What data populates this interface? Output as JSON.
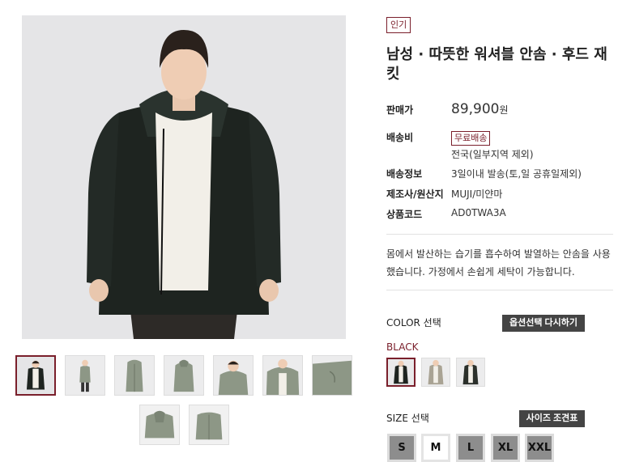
{
  "product": {
    "badge": "인기",
    "title": "남성 · 따뜻한 워셔블 안솜 · 후드 재킷",
    "price_label": "판매가",
    "price": "89,900",
    "price_unit": "원",
    "shipping_label": "배송비",
    "shipping_badge": "무료배송",
    "shipping_note": "전국(일부지역 제외)",
    "delivery_label": "배송정보",
    "delivery_value": "3일이내 발송(토,일 공휴일제외)",
    "maker_label": "제조사/원산지",
    "maker_value": "MUJI/미얀마",
    "code_label": "상품코드",
    "code_value": "AD0TWA3A",
    "description": "몸에서 발산하는 습기를 흡수하여 발열하는 안솜을 사용했습니다. 가정에서 손쉽게 세탁이 가능합니다."
  },
  "options": {
    "color_label": "COLOR 선택",
    "reset_label": "옵션선택 다시하기",
    "selected_color": "BLACK",
    "size_label": "SIZE 선택",
    "size_chart_label": "사이즈 조견표",
    "sizes": [
      "S",
      "M",
      "L",
      "XL",
      "XXL"
    ],
    "selected_size": "M"
  },
  "gallery": {
    "main_image": "black-hooded-jacket-model-photo",
    "thumbnail_count": 9,
    "selected_thumbnail": 0
  },
  "colors": {
    "black_jacket": "#1e2420",
    "khaki_jacket": "#8d9786",
    "beige_jacket": "#a9a394",
    "accent": "#7a1f2b"
  }
}
